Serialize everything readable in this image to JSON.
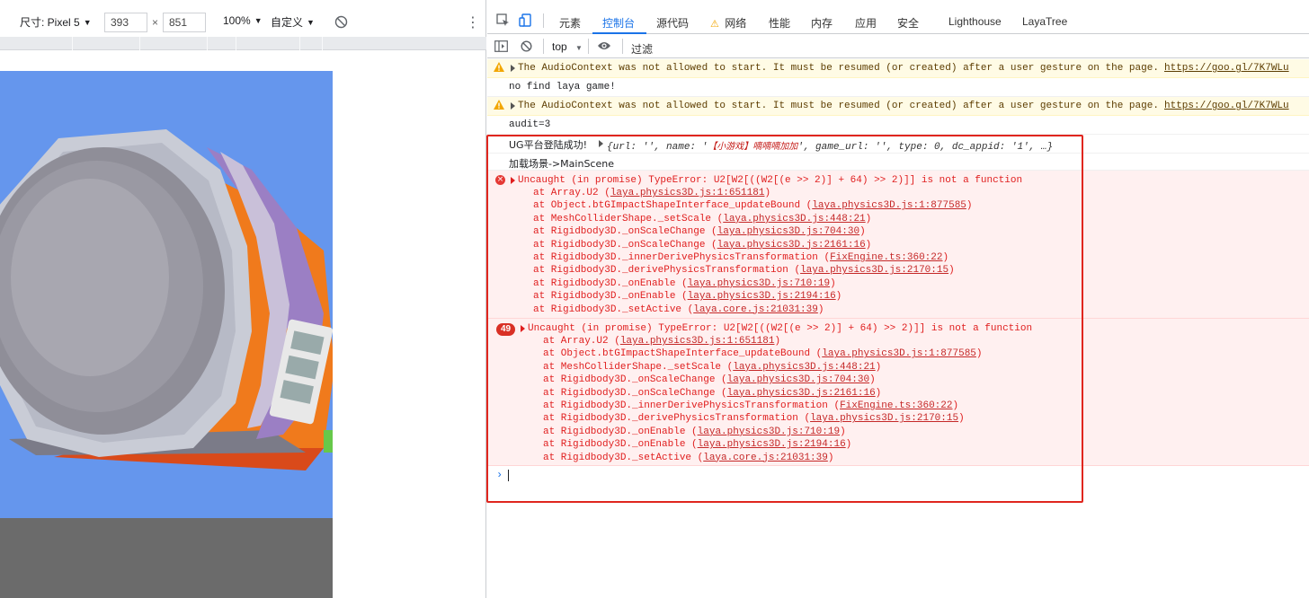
{
  "device_toolbar": {
    "dimensions_label": "尺寸: Pixel 5",
    "width_value": "393",
    "times": "×",
    "height_value": "851",
    "zoom": "100%",
    "throttle": "自定义",
    "rotate_icon": "rotate-icon",
    "more_icon": "more-vert-icon"
  },
  "devtools_tabs": {
    "items": [
      "元素",
      "控制台",
      "源代码",
      "网络",
      "性能",
      "内存",
      "应用",
      "安全",
      "Lighthouse",
      "LayaTree"
    ],
    "active": "控制台"
  },
  "console_toolbar": {
    "context": "top",
    "filter_placeholder": "过滤"
  },
  "colors": {
    "accent": "#1a73e8",
    "error": "#e01e1e",
    "warning_bg": "#fffbe5",
    "error_bg": "#fff0f0",
    "highlight_box": "#e0261e",
    "viewport_bg": "#6596ed"
  },
  "messages": {
    "warn1": {
      "text": "The AudioContext was not allowed to start. It must be resumed (or created) after a user gesture on the page. ",
      "link": "https://goo.gl/7K7WLu"
    },
    "log1": "no find laya game!",
    "warn2": {
      "text": "The AudioContext was not allowed to start. It must be resumed (or created) after a user gesture on the page. ",
      "link": "https://goo.gl/7K7WLu"
    },
    "log2": "audit=3",
    "log3": {
      "prefix": "UG平台登陆成功!",
      "object_a": "{url: '', name: '",
      "object_b": "【小游戏】嘀嘀嘀加加",
      "object_c": "', game_url: '', type: 0, dc_appid: '1', …}"
    },
    "log4": "加载场景->MainScene",
    "error1": {
      "header": "Uncaught (in promise) TypeError: U2[W2[((W2[(e >> 2)] + 64) >> 2)]] is not a function",
      "stack": [
        {
          "text": "at Array.U2 (",
          "link": "laya.physics3D.js:1:651181",
          "end": ")"
        },
        {
          "text": "at Object.btGImpactShapeInterface_updateBound (",
          "link": "laya.physics3D.js:1:877585",
          "end": ")"
        },
        {
          "text": "at MeshColliderShape._setScale (",
          "link": "laya.physics3D.js:448:21",
          "end": ")"
        },
        {
          "text": "at Rigidbody3D._onScaleChange (",
          "link": "laya.physics3D.js:704:30",
          "end": ")"
        },
        {
          "text": "at Rigidbody3D._onScaleChange (",
          "link": "laya.physics3D.js:2161:16",
          "end": ")"
        },
        {
          "text": "at Rigidbody3D._innerDerivePhysicsTransformation (",
          "link": "FixEngine.ts:360:22",
          "end": ")"
        },
        {
          "text": "at Rigidbody3D._derivePhysicsTransformation (",
          "link": "laya.physics3D.js:2170:15",
          "end": ")"
        },
        {
          "text": "at Rigidbody3D._onEnable (",
          "link": "laya.physics3D.js:710:19",
          "end": ")"
        },
        {
          "text": "at Rigidbody3D._onEnable (",
          "link": "laya.physics3D.js:2194:16",
          "end": ")"
        },
        {
          "text": "at Rigidbody3D._setActive (",
          "link": "laya.core.js:21031:39",
          "end": ")"
        }
      ]
    },
    "error2": {
      "count": "49",
      "header": "Uncaught (in promise) TypeError: U2[W2[((W2[(e >> 2)] + 64) >> 2)]] is not a function",
      "stack": [
        {
          "text": "at Array.U2 (",
          "link": "laya.physics3D.js:1:651181",
          "end": ")"
        },
        {
          "text": "at Object.btGImpactShapeInterface_updateBound (",
          "link": "laya.physics3D.js:1:877585",
          "end": ")"
        },
        {
          "text": "at MeshColliderShape._setScale (",
          "link": "laya.physics3D.js:448:21",
          "end": ")"
        },
        {
          "text": "at Rigidbody3D._onScaleChange (",
          "link": "laya.physics3D.js:704:30",
          "end": ")"
        },
        {
          "text": "at Rigidbody3D._onScaleChange (",
          "link": "laya.physics3D.js:2161:16",
          "end": ")"
        },
        {
          "text": "at Rigidbody3D._innerDerivePhysicsTransformation (",
          "link": "FixEngine.ts:360:22",
          "end": ")"
        },
        {
          "text": "at Rigidbody3D._derivePhysicsTransformation (",
          "link": "laya.physics3D.js:2170:15",
          "end": ")"
        },
        {
          "text": "at Rigidbody3D._onEnable (",
          "link": "laya.physics3D.js:710:19",
          "end": ")"
        },
        {
          "text": "at Rigidbody3D._onEnable (",
          "link": "laya.physics3D.js:2194:16",
          "end": ")"
        },
        {
          "text": "at Rigidbody3D._setActive (",
          "link": "laya.core.js:21031:39",
          "end": ")"
        }
      ]
    }
  }
}
